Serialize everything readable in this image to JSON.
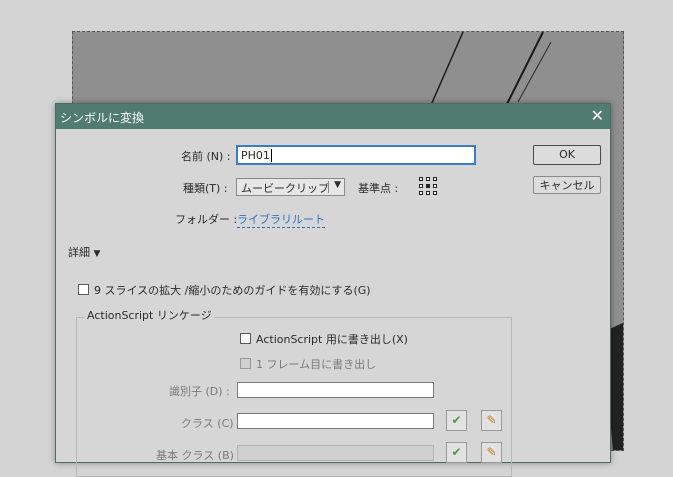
{
  "dialog": {
    "title": "シンボルに変換",
    "close_glyph": "✕"
  },
  "form": {
    "name_label": "名前 (N) :",
    "name_value": "PH01",
    "type_label": "種類(T) :",
    "type_value": "ムービークリップ",
    "registration_label": "基準点 :",
    "folder_label": "フォルダー :",
    "folder_value": "ライブラリルート",
    "details_label": "詳細",
    "nine_slice_label": "9 スライスの拡大 /縮小のためのガイドを有効にする(G)"
  },
  "buttons": {
    "ok": "OK",
    "cancel": "キャンセル"
  },
  "actionscript": {
    "group_title": "ActionScript リンケージ",
    "export_label": "ActionScript 用に書き出し(X)",
    "first_frame_label": "1 フレーム目に書き出し",
    "identifier_label": "識別子 (D) :",
    "class_label": "クラス (C) :",
    "base_class_label": "基本 クラス (B) :"
  },
  "icons": {
    "check": "check-icon",
    "pencil": "pencil-icon"
  }
}
